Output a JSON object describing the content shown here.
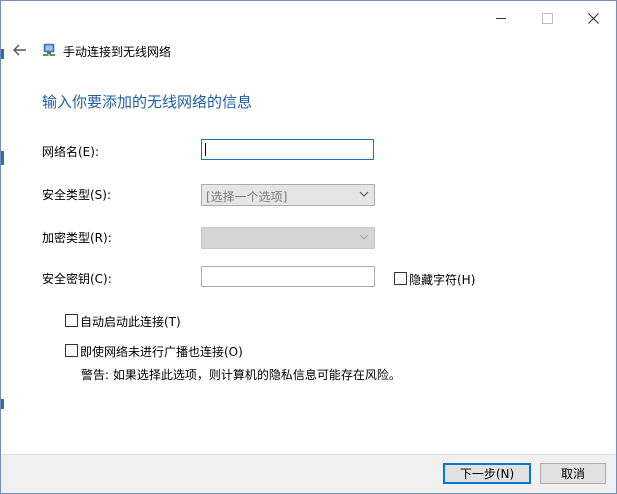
{
  "window": {
    "caption": {
      "minimize_icon": "minimize-icon",
      "maximize_icon": "maximize-icon",
      "close_icon": "close-icon"
    }
  },
  "header": {
    "back_icon": "back-arrow-icon",
    "app_icon": "wireless-network-icon",
    "title": "手动连接到无线网络"
  },
  "main": {
    "heading": "输入你要添加的无线网络的信息",
    "network_name": {
      "label": "网络名(E):",
      "value": ""
    },
    "security_type": {
      "label": "安全类型(S):",
      "selected": "[选择一个选项]"
    },
    "encryption_type": {
      "label": "加密类型(R):",
      "selected": ""
    },
    "security_key": {
      "label": "安全密钥(C):",
      "value": "",
      "hide_chars_label": "隐藏字符(H)",
      "hide_chars_checked": false
    },
    "auto_start": {
      "label": "自动启动此连接(T)",
      "checked": false
    },
    "connect_no_broadcast": {
      "label": "即使网络未进行广播也连接(O)",
      "checked": false
    },
    "warning": "警告: 如果选择此选项，则计算机的隐私信息可能存在风险。"
  },
  "footer": {
    "next_label": "下一步(N)",
    "cancel_label": "取消"
  },
  "colors": {
    "heading": "#1e5fa8",
    "accent": "#0078d7",
    "footer_bg": "#f0f0f0"
  }
}
